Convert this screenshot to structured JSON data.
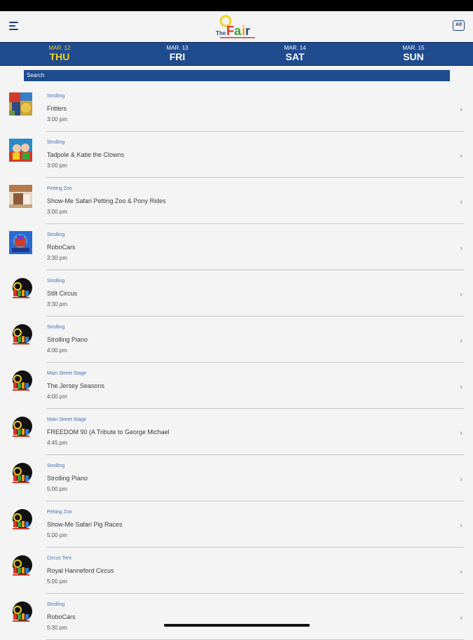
{
  "header": {
    "logo": {
      "alt_text": "The Fair"
    },
    "all_button_label": "All"
  },
  "days": [
    {
      "date": "MAR. 12",
      "name": "THU",
      "active": true
    },
    {
      "date": "MAR. 13",
      "name": "FRI",
      "active": false
    },
    {
      "date": "MAR. 14",
      "name": "SAT",
      "active": false
    },
    {
      "date": "MAR. 15",
      "name": "SUN",
      "active": false
    }
  ],
  "search": {
    "label": "Search"
  },
  "events": [
    {
      "category": "Strolling",
      "title": "Fritters",
      "time": "3:00 pm",
      "thumb": "fritters"
    },
    {
      "category": "Strolling",
      "title": "Tadpole & Katie the Clowns",
      "time": "3:00 pm",
      "thumb": "clowns"
    },
    {
      "category": "Petting Zoo",
      "title": "Show-Me Safari Petting Zoo & Pony Rides",
      "time": "3:00 pm",
      "thumb": "petting-zoo"
    },
    {
      "category": "Strolling",
      "title": "RoboCars",
      "time": "3:30 pm",
      "thumb": "robocars"
    },
    {
      "category": "Strolling",
      "title": "Stilt Circus",
      "time": "3:30 pm",
      "thumb": "fair-logo"
    },
    {
      "category": "Strolling",
      "title": "Strolling Piano",
      "time": "4:00 pm",
      "thumb": "fair-logo"
    },
    {
      "category": "Main Street Stage",
      "title": "The Jersey Seasons",
      "time": "4:00 pm",
      "thumb": "fair-logo"
    },
    {
      "category": "Main Street Stage",
      "title": "FREEDOM 90 (A Tribute to George Michael",
      "time": "4:45 pm",
      "thumb": "fair-logo"
    },
    {
      "category": "Strolling",
      "title": "Strolling Piano",
      "time": "5:00 pm",
      "thumb": "fair-logo"
    },
    {
      "category": "Petting Zoo",
      "title": "Show-Me Safari Pig Races",
      "time": "5:00 pm",
      "thumb": "fair-logo"
    },
    {
      "category": "Circus Tent",
      "title": "Royal Hanneford Circus",
      "time": "5:00 pm",
      "thumb": "fair-logo"
    },
    {
      "category": "Strolling",
      "title": "RoboCars",
      "time": "5:30 pm",
      "thumb": "fair-logo"
    }
  ],
  "colors": {
    "brand_blue": "#1f4b8f",
    "active_day": "#f3d21e",
    "category": "#4a6fae"
  }
}
